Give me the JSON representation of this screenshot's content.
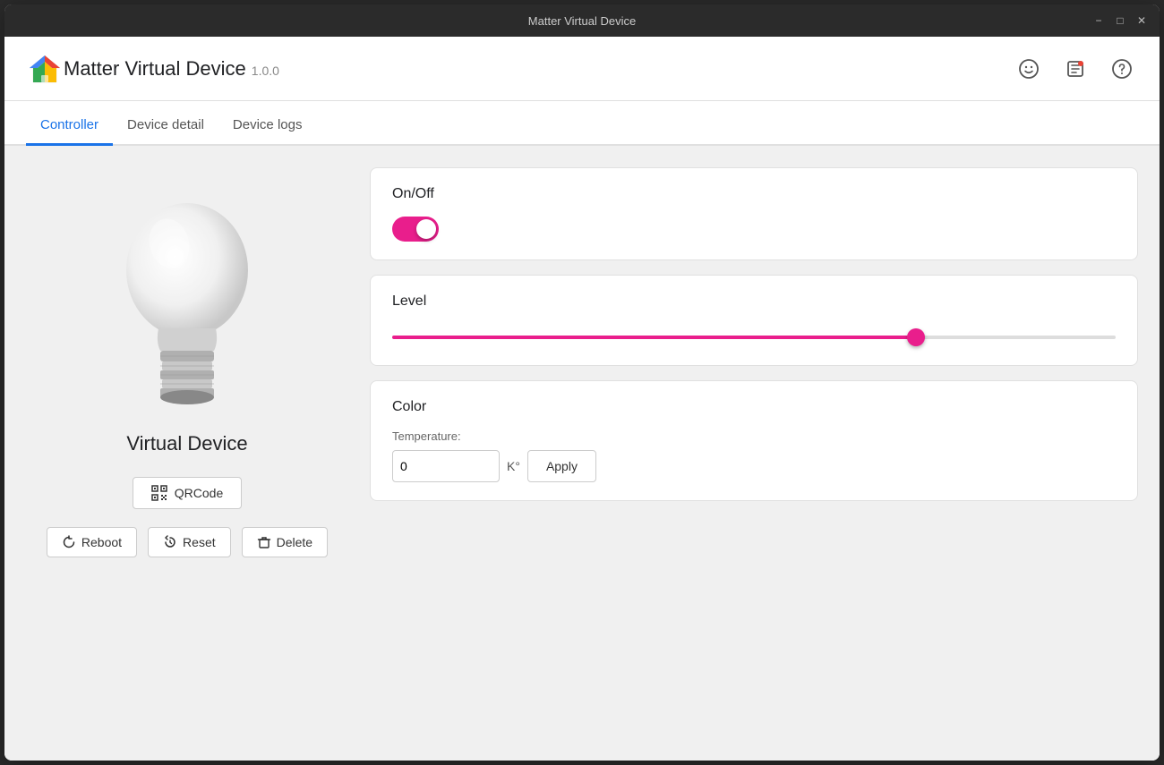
{
  "titlebar": {
    "title": "Matter Virtual Device",
    "minimize_label": "−",
    "maximize_label": "□",
    "close_label": "✕"
  },
  "header": {
    "app_title": "Matter Virtual Device",
    "app_version": "1.0.0"
  },
  "header_icons": {
    "emoji_label": "😊",
    "feedback_label": "⊡",
    "help_label": "?"
  },
  "tabs": [
    {
      "id": "controller",
      "label": "Controller",
      "active": true
    },
    {
      "id": "device-detail",
      "label": "Device detail",
      "active": false
    },
    {
      "id": "device-logs",
      "label": "Device logs",
      "active": false
    }
  ],
  "left_panel": {
    "device_name": "Virtual Device",
    "qrcode_button": "QRCode",
    "reboot_button": "Reboot",
    "reset_button": "Reset",
    "delete_button": "Delete"
  },
  "cards": {
    "on_off": {
      "title": "On/Off",
      "toggle_state": true
    },
    "level": {
      "title": "Level",
      "value": 73
    },
    "color": {
      "title": "Color",
      "temperature_label": "Temperature:",
      "temperature_value": "0",
      "unit": "K°",
      "apply_button": "Apply"
    }
  }
}
